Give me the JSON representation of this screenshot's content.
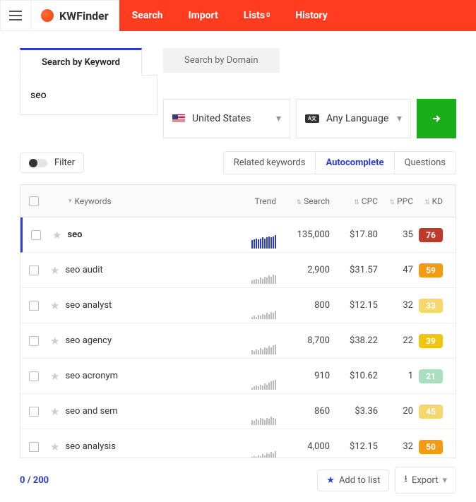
{
  "brand": "KWFinder",
  "nav": [
    "Search",
    "Import",
    "Lists",
    "History"
  ],
  "nav_badge": "0",
  "tabs": {
    "kw": "Search by Keyword",
    "dom": "Search by Domain"
  },
  "input": "seo",
  "location": "United States",
  "lang": "Any Language",
  "lang_ic": "A文",
  "filter": "Filter",
  "pills": {
    "rel": "Related keywords",
    "auto": "Autocomplete",
    "q": "Questions"
  },
  "cols": {
    "kw": "Keywords",
    "trend": "Trend",
    "search": "Search",
    "cpc": "CPC",
    "ppc": "PPC",
    "kd": "KD"
  },
  "rows": [
    {
      "kw": "seo",
      "sv": "135,000",
      "cpc": "$17.80",
      "ppc": "35",
      "kd": "76",
      "kdc": "#c0392b",
      "sel": true,
      "t": [
        8,
        9,
        10,
        9,
        10,
        11,
        10,
        11,
        12,
        11,
        12,
        13
      ]
    },
    {
      "kw": "seo audit",
      "sv": "2,900",
      "cpc": "$31.57",
      "ppc": "47",
      "kd": "59",
      "kdc": "#f39c12",
      "t": [
        3,
        4,
        5,
        4,
        6,
        5,
        7,
        6,
        8,
        7,
        9,
        8
      ]
    },
    {
      "kw": "seo analyst",
      "sv": "800",
      "cpc": "$12.15",
      "ppc": "32",
      "kd": "33",
      "kdc": "#f6d76b",
      "t": [
        2,
        3,
        2,
        4,
        3,
        5,
        4,
        6,
        5,
        7,
        6,
        8
      ]
    },
    {
      "kw": "seo agency",
      "sv": "8,700",
      "cpc": "$38.22",
      "ppc": "22",
      "kd": "39",
      "kdc": "#f1c40f",
      "t": [
        4,
        3,
        5,
        4,
        6,
        5,
        7,
        6,
        8,
        7,
        9,
        10
      ]
    },
    {
      "kw": "seo acronym",
      "sv": "910",
      "cpc": "$10.62",
      "ppc": "1",
      "kd": "21",
      "kdc": "#a9dfbf",
      "t": [
        2,
        3,
        4,
        3,
        5,
        4,
        6,
        5,
        7,
        8,
        9,
        10
      ]
    },
    {
      "kw": "seo and sem",
      "sv": "860",
      "cpc": "$3.36",
      "ppc": "20",
      "kd": "45",
      "kdc": "#f6d76b",
      "t": [
        5,
        4,
        6,
        5,
        7,
        6,
        5,
        7,
        6,
        8,
        7,
        6
      ]
    },
    {
      "kw": "seo analysis",
      "sv": "4,000",
      "cpc": "$12.15",
      "ppc": "32",
      "kd": "50",
      "kdc": "#f39c12",
      "t": [
        3,
        4,
        3,
        5,
        4,
        6,
        5,
        7,
        6,
        8,
        7,
        9
      ]
    }
  ],
  "count": "0 / 200",
  "addlist": "Add to list",
  "export": "Export"
}
